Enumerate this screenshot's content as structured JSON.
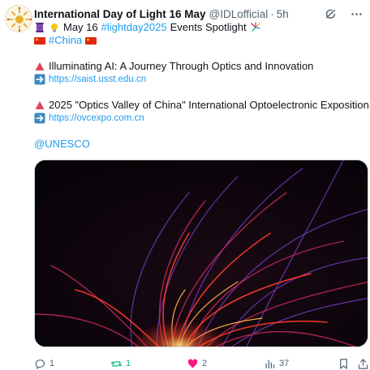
{
  "author": {
    "name": "International Day of Light 16 May",
    "handle": "@IDLofficial",
    "separator": "·",
    "time": "5h"
  },
  "post": {
    "line1_text": "May 16",
    "line1_hashtag": "#lightday2025",
    "line1_suffix": "Events Spotlight",
    "line2_hashtag": "#China",
    "item1_title": "Illuminating AI: A Journey Through Optics and Innovation",
    "item1_link": "https://saist.usst.edu.cn",
    "item2_title": "2025 \"Optics Valley of China\" International Optoelectronic Exposition",
    "item2_link": "https://ovcexpo.com.cn",
    "mention": "@UNESCO"
  },
  "media": {
    "description_icon": "light-fiber-image"
  },
  "actions": {
    "replies": "1",
    "reposts": "1",
    "likes": "2",
    "views": "37"
  },
  "icons": {
    "grok": "grok-icon",
    "more": "more-icon",
    "reply": "reply-icon",
    "repost": "repost-icon",
    "like": "heart-icon",
    "views": "views-icon",
    "bookmark": "bookmark-icon",
    "share": "share-icon"
  },
  "colors": {
    "link": "#1d9bf0",
    "muted": "#536471",
    "repost": "#00ba7c",
    "like": "#f91880"
  }
}
